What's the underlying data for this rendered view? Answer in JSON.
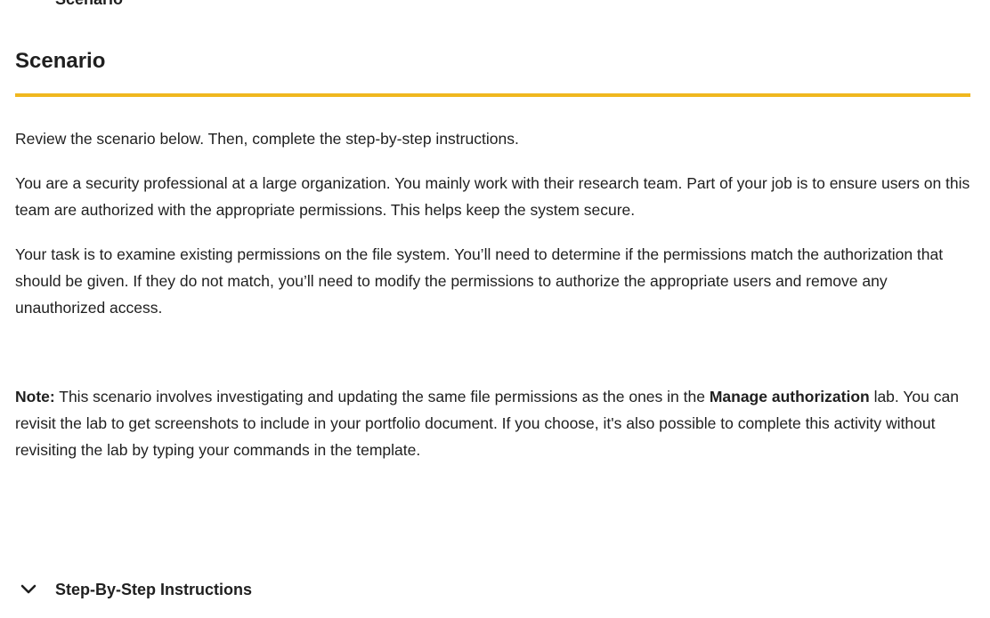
{
  "previous_item": {
    "label": "Scenario"
  },
  "section": {
    "title": "Scenario",
    "accent_color": "#f0b71e",
    "paragraphs": [
      "Review the scenario below. Then, complete the step-by-step instructions.",
      "You are a security professional at a large organization. You mainly work with their research team. Part of your job is to ensure users on this team are authorized with the appropriate permissions. This helps keep the system secure.",
      "Your task is to examine existing permissions on the file system. You’ll need to determine if the permissions match the authorization that should be given. If they do not match, you’ll need to modify the permissions to authorize the appropriate users and remove any unauthorized access."
    ],
    "note": {
      "label": "Note:",
      "text_before": " This scenario involves investigating and updating the same file permissions as the ones in the ",
      "lab_name": "Manage authorization",
      "text_after": " lab. You can revisit the lab to get screenshots to include in your portfolio document. If you choose, it's also possible to complete this activity without revisiting the lab by typing your commands in the template."
    }
  },
  "collapsible": {
    "label": "Step-By-Step Instructions",
    "icon": "chevron-down-icon"
  }
}
